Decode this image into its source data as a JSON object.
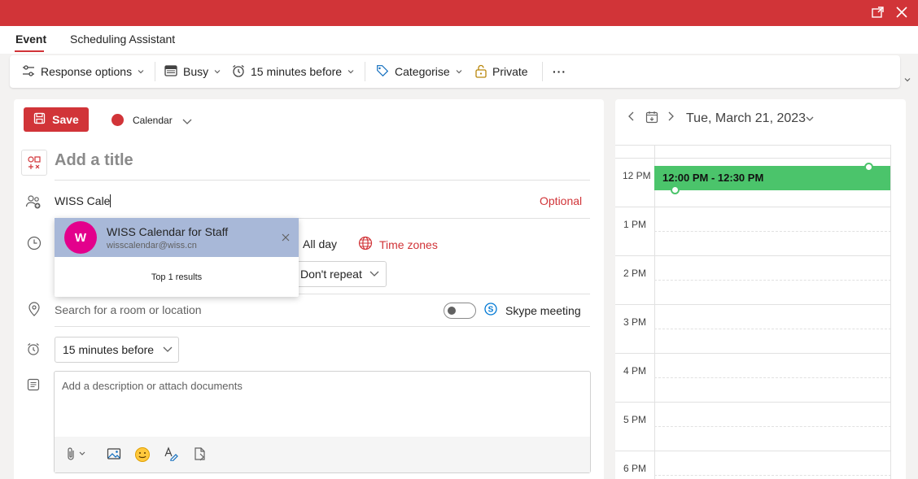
{
  "tabs": {
    "event": "Event",
    "scheduling": "Scheduling Assistant"
  },
  "toolbar": {
    "response_options": "Response options",
    "show_as": "Busy",
    "reminder": "15 minutes before",
    "categorise": "Categorise",
    "private": "Private",
    "more": "···"
  },
  "form": {
    "save": "Save",
    "calendar": "Calendar",
    "title_placeholder": "Add a title",
    "attendee_value": "WISS Cale",
    "optional": "Optional",
    "all_day": "All day",
    "time_zones": "Time zones",
    "repeat": "Don't repeat",
    "location_placeholder": "Search for a room or location",
    "skype_meeting": "Skype meeting",
    "skype_enabled": false,
    "reminder": "15 minutes before",
    "description_placeholder": "Add a description or attach documents"
  },
  "suggestions": {
    "items": [
      {
        "initial": "W",
        "name": "WISS Calendar for Staff",
        "email": "wisscalendar@wiss.cn"
      }
    ],
    "summary": "Top 1 results"
  },
  "calendar_pane": {
    "date": "Tue, March 21, 2023",
    "hours": [
      "12 PM",
      "1 PM",
      "2 PM",
      "3 PM",
      "4 PM",
      "5 PM",
      "6 PM"
    ],
    "event": "12:00 PM - 12:30 PM"
  },
  "colors": {
    "accent": "#d13438",
    "event_fill": "#4bc46b",
    "selected_suggestion": "#a8b8d8",
    "avatar": "#e3008c"
  }
}
